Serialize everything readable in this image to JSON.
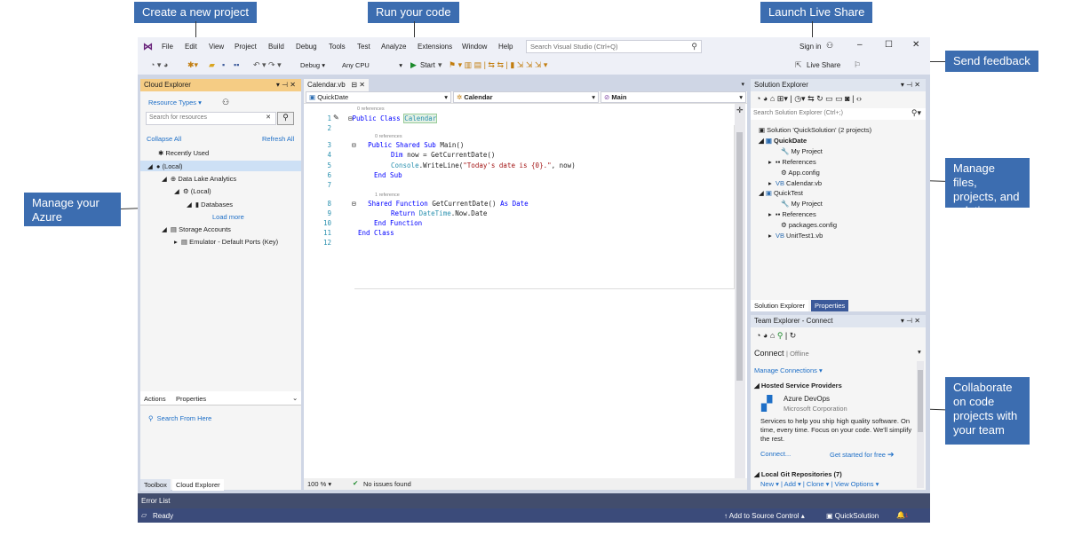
{
  "callouts": {
    "create_project": "Create a new project",
    "run_code": "Run your code",
    "live_share": "Launch Live Share",
    "send_feedback": "Send feedback",
    "manage_azure": "Manage your\nAzure resources",
    "manage_files": "Manage files,\nprojects, and\nsolutions",
    "collaborate": "Collaborate\non code\nprojects with\nyour team"
  },
  "menu": [
    "File",
    "Edit",
    "View",
    "Project",
    "Build",
    "Debug",
    "Tools",
    "Test",
    "Analyze",
    "Extensions",
    "Window",
    "Help"
  ],
  "search": {
    "placeholder": "Search Visual Studio (Ctrl+Q)"
  },
  "account": {
    "sign_in": "Sign in",
    "live_share": "Live Share"
  },
  "toolbar": {
    "config": "Debug",
    "platform": "Any CPU",
    "start": "Start"
  },
  "cloud_explorer": {
    "title": "Cloud Explorer",
    "resource_types": "Resource Types",
    "search_placeholder": "Search for resources",
    "collapse_all": "Collapse All",
    "refresh_all": "Refresh All",
    "tree": [
      "Recently Used",
      "(Local)",
      "Data Lake Analytics",
      "(Local)",
      "Databases",
      "Load more",
      "Storage Accounts",
      "Emulator - Default Ports (Key)"
    ],
    "tabs": [
      "Actions",
      "Properties"
    ],
    "action": "Search From Here",
    "bottom_tabs": [
      "Toolbox",
      "Cloud Explorer"
    ]
  },
  "editor": {
    "tab": "Calendar.vb",
    "nav": [
      "QuickDate",
      "Calendar",
      "Main"
    ],
    "refs": [
      "0 references",
      "0 references",
      "1 reference"
    ],
    "lines": [
      "1",
      "2",
      "3",
      "4",
      "5",
      "6",
      "7",
      "8",
      "9",
      "10",
      "11",
      "12"
    ],
    "code": {
      "l1a": "Public Class ",
      "l1b": "Calendar",
      "l3a": "Public Shared Sub ",
      "l3b": "Main()",
      "l4a": "Dim ",
      "l4b": "now = GetCurrentDate()",
      "l5a": "Console",
      "l5b": ".WriteLine(",
      "l5c": "\"Today's date is {0}.\"",
      "l5d": ", now)",
      "l6": "End Sub",
      "l8a": "Shared Function ",
      "l8b": "GetCurrentDate() ",
      "l8c": "As Date",
      "l9a": "Return ",
      "l9b": "DateTime",
      "l9c": ".Now.Date",
      "l10": "End Function",
      "l11": "End Class"
    },
    "zoom": "100 %",
    "issues": "No issues found"
  },
  "solution_explorer": {
    "title": "Solution Explorer",
    "search_placeholder": "Search Solution Explorer (Ctrl+;)",
    "tree": [
      "Solution 'QuickSolution' (2 projects)",
      "QuickDate",
      "My Project",
      "References",
      "App.config",
      "Calendar.vb",
      "QuickTest",
      "My Project",
      "References",
      "packages.config",
      "UnitTest1.vb"
    ],
    "tabs": [
      "Solution Explorer",
      "Properties"
    ]
  },
  "team_explorer": {
    "title": "Team Explorer - Connect",
    "connect": "Connect",
    "offline": "Offline",
    "manage": "Manage Connections",
    "hosted": "Hosted Service Providers",
    "azure_title": "Azure DevOps",
    "azure_sub": "Microsoft Corporation",
    "azure_desc": "Services to help you ship high quality software. On time, every time. Focus on your code. We'll simplify the rest.",
    "connect_link": "Connect...",
    "started": "Get started for free",
    "local_git": "Local Git Repositories (7)",
    "git_actions": [
      "New",
      "Add",
      "Clone",
      "View Options"
    ]
  },
  "status": {
    "error_list": "Error List",
    "ready": "Ready",
    "source_control": "Add to Source Control",
    "solution": "QuickSolution"
  },
  "colors": {
    "accent": "#3c6db0",
    "status_bar": "#3b4b7a",
    "active_title": "#f5cc84"
  }
}
